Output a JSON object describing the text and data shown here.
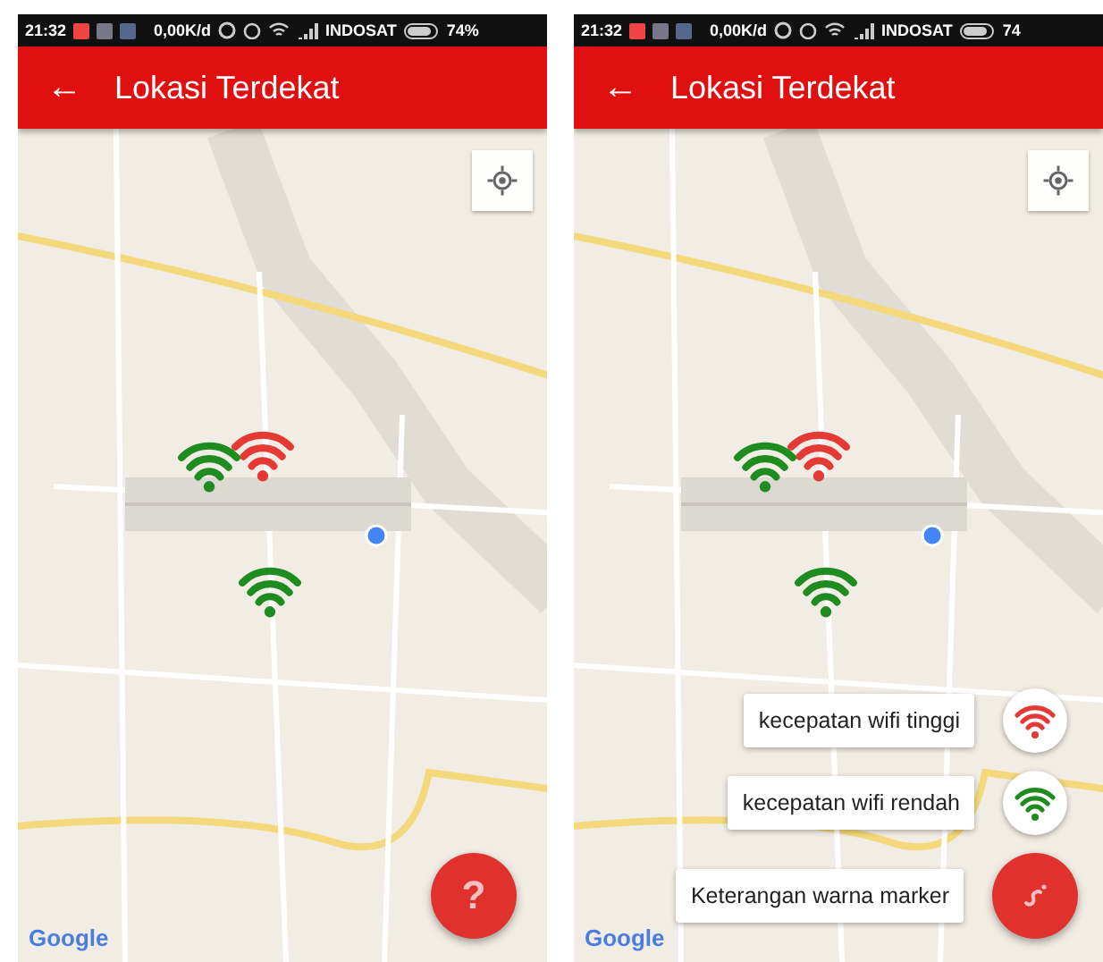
{
  "screens": [
    {
      "status_bar": {
        "time": "21:32",
        "speed": "0,00K/d",
        "carrier": "INDOSAT",
        "battery": "74%"
      },
      "app_bar": {
        "back": "←",
        "title": "Lokasi Terdekat"
      },
      "markers": [
        {
          "color": "#e53935"
        },
        {
          "color": "#1e8c1e"
        },
        {
          "color": "#1e8c1e"
        }
      ],
      "attribution": "Google",
      "fab": {
        "kind": "help",
        "label": "?"
      }
    },
    {
      "status_bar": {
        "time": "21:32",
        "speed": "0,00K/d",
        "carrier": "INDOSAT",
        "battery": "74"
      },
      "app_bar": {
        "back": "←",
        "title": "Lokasi Terdekat"
      },
      "markers": [
        {
          "color": "#e53935"
        },
        {
          "color": "#1e8c1e"
        },
        {
          "color": "#1e8c1e"
        }
      ],
      "legend": [
        {
          "label": "kecepatan wifi tinggi",
          "color": "#e53935"
        },
        {
          "label": "kecepatan wifi rendah",
          "color": "#1e8c1e"
        }
      ],
      "legend_title": "Keterangan warna marker",
      "attribution": "Google",
      "fab": {
        "kind": "close"
      }
    }
  ]
}
